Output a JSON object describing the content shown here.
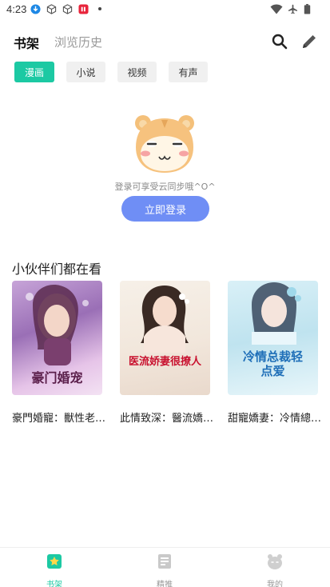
{
  "status_bar": {
    "time": "4:23"
  },
  "header": {
    "tab_bookshelf": "书架",
    "tab_history": "浏览历史"
  },
  "filters": [
    "漫画",
    "小说",
    "视频",
    "有声"
  ],
  "empty_state": {
    "hint": "登录可享受云同步哦^O^",
    "login_button": "立即登录"
  },
  "recommend": {
    "title": "小伙伴们都在看",
    "books": [
      {
        "title": "豪門婚寵：獸性老…",
        "cover_text": "豪门婚宠"
      },
      {
        "title": "此情致深：醫流嬌…",
        "cover_text": "医流娇妻很撩人"
      },
      {
        "title": "甜寵嬌妻：冷情總…",
        "cover_text": "冷情总裁轻点爱"
      }
    ]
  },
  "bottom_nav": {
    "items": [
      {
        "label": "书架"
      },
      {
        "label": "精推"
      },
      {
        "label": "我的"
      }
    ]
  },
  "colors": {
    "accent": "#1cc9a3",
    "login_button": "#6f8ef5"
  }
}
